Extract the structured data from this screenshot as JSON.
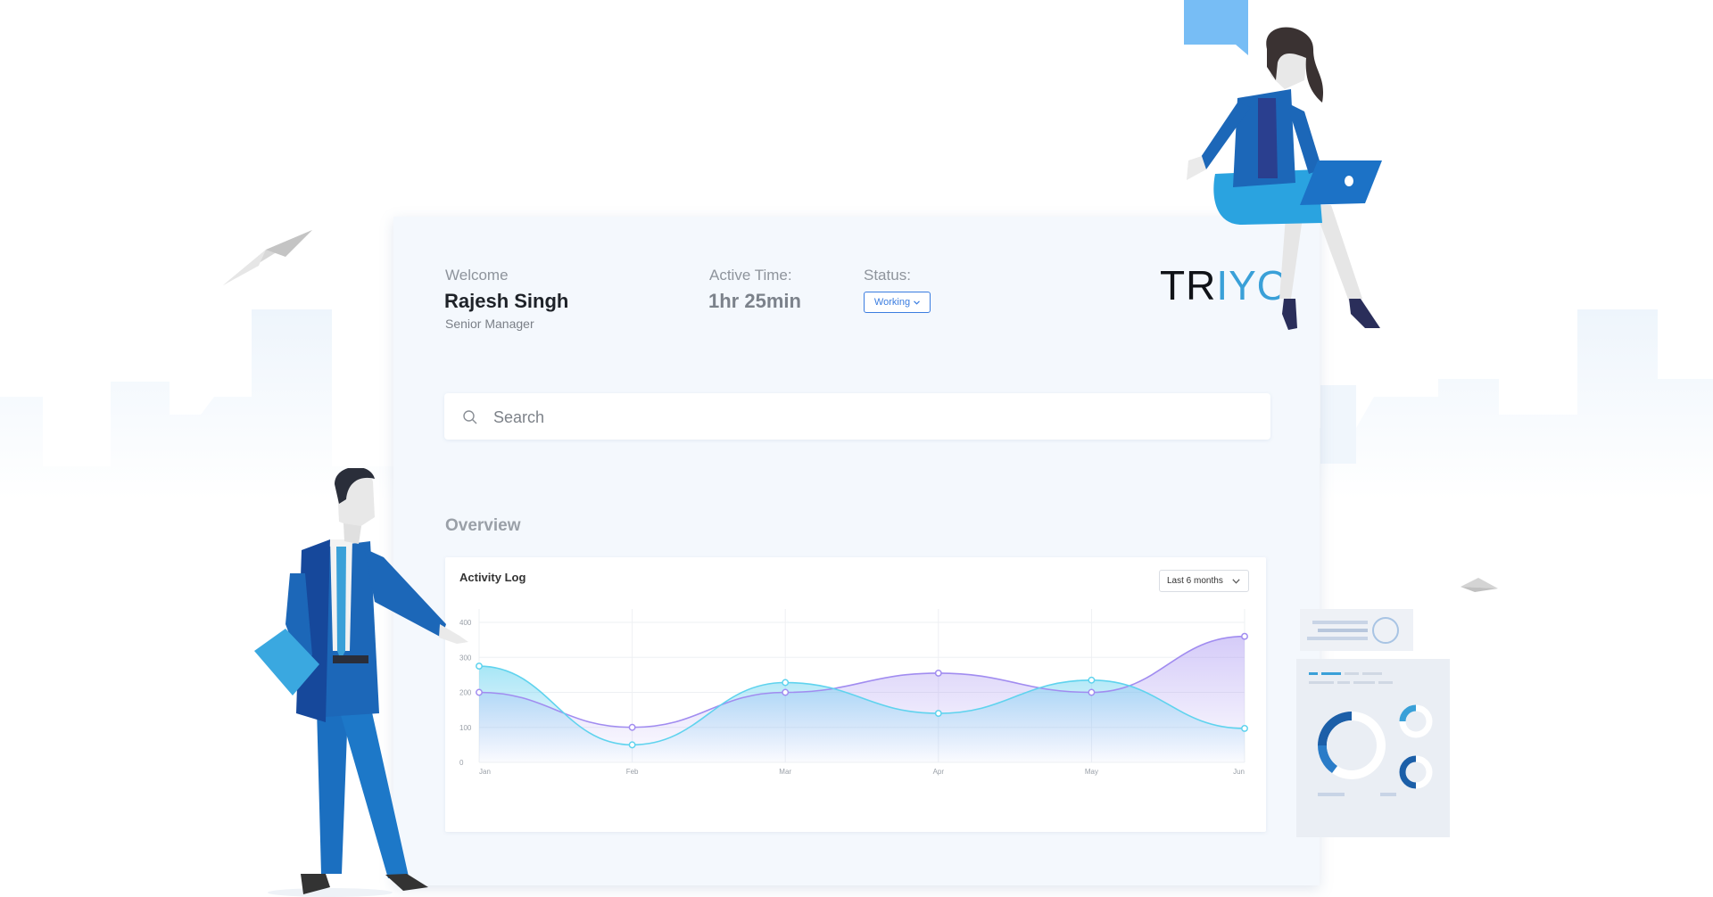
{
  "header": {
    "welcome_label": "Welcome",
    "user_name": "Rajesh Singh",
    "user_role": "Senior Manager",
    "active_time_label": "Active Time:",
    "active_time_value": "1hr 25min",
    "status_label": "Status:",
    "status_value": "Working"
  },
  "logo": {
    "part1": "TR",
    "part2": "I",
    "part3": "YO"
  },
  "search": {
    "placeholder": "Search"
  },
  "overview": {
    "title": "Overview",
    "activity_log": {
      "title": "Activity Log",
      "range_selected": "Last 6 months"
    }
  },
  "colors": {
    "accent_blue": "#3b7de0",
    "series_purple": "#a18cf0",
    "series_cyan": "#5fd3ee",
    "logo_blue": "#3aa0d8"
  },
  "chart_data": {
    "type": "area",
    "title": "Activity Log",
    "categories": [
      "Jan",
      "Feb",
      "Mar",
      "Apr",
      "May",
      "Jun"
    ],
    "y_ticks": [
      "0",
      "100",
      "200",
      "300",
      "400"
    ],
    "ylim": [
      0,
      400
    ],
    "series": [
      {
        "values": [
          200,
          100,
          200,
          255,
          200,
          360
        ],
        "color": "#a18cf0"
      },
      {
        "values": [
          275,
          50,
          228,
          140,
          235,
          97
        ],
        "color": "#5fd3ee"
      }
    ],
    "grid": true
  }
}
